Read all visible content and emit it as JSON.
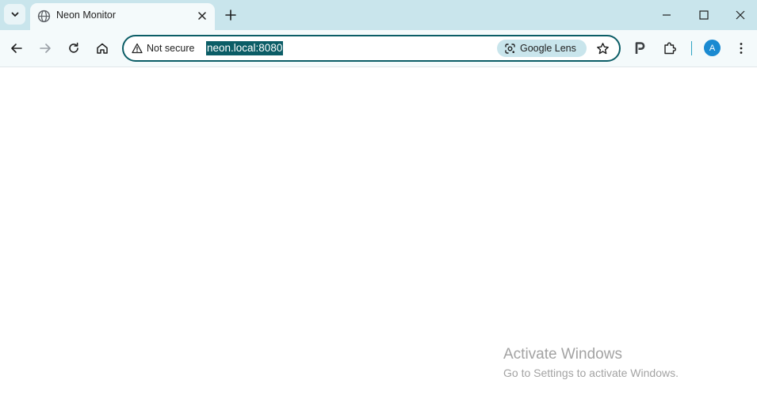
{
  "browser": {
    "tab": {
      "title": "Neon Monitor",
      "favicon": "globe-icon"
    },
    "omnibox": {
      "security_label": "Not secure",
      "url": "neon.local:8080",
      "lens_label": "Google Lens"
    },
    "profile_initial": "A"
  },
  "watermark": {
    "title": "Activate Windows",
    "subtitle": "Go to Settings to activate Windows."
  },
  "colors": {
    "tabstrip_bg": "#c9e5ec",
    "toolbar_bg": "#f4fafb",
    "omnibox_border": "#0b5d66",
    "url_highlight": "#0b5d66",
    "avatar": "#1a8ad1"
  }
}
